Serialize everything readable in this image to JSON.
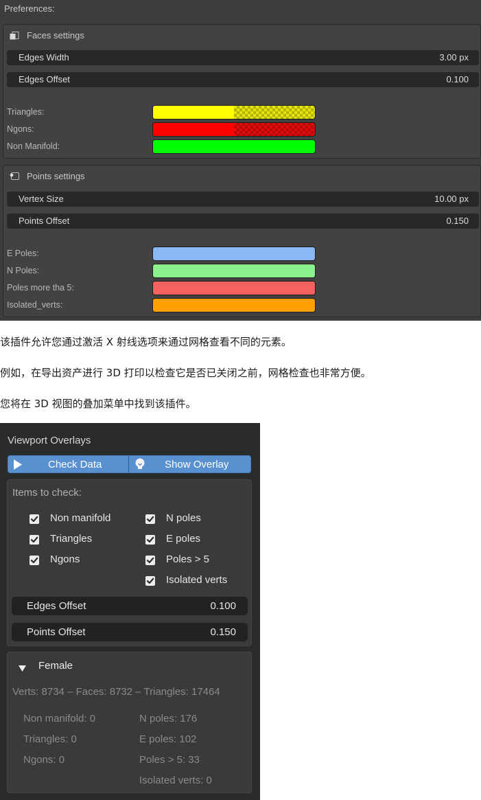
{
  "preferences": {
    "header": "Preferences:",
    "faces": {
      "title": "Faces settings",
      "icon": "faces-panel-icon",
      "edges_width": {
        "label": "Edges Width",
        "value": "3.00 px"
      },
      "edges_offset": {
        "label": "Edges Offset",
        "value": "0.100"
      },
      "colors": [
        {
          "label": "Triangles:",
          "color": "#ffff00",
          "alpha_checker": true
        },
        {
          "label": "Ngons:",
          "color": "#ff0000",
          "alpha_checker": true
        },
        {
          "label": "Non Manifold:",
          "color": "#00ff00",
          "alpha_checker": false
        }
      ]
    },
    "points": {
      "title": "Points settings",
      "icon": "points-panel-icon",
      "vertex_size": {
        "label": "Vertex Size",
        "value": "10.00 px"
      },
      "points_offset": {
        "label": "Points Offset",
        "value": "0.150"
      },
      "colors": [
        {
          "label": "E Poles:",
          "color": "#8ab8f7"
        },
        {
          "label": "N Poles:",
          "color": "#8cf08c"
        },
        {
          "label": "Poles more tha 5:",
          "color": "#f56161"
        },
        {
          "label": "Isolated_verts:",
          "color": "#ff9f00"
        }
      ]
    }
  },
  "paragraphs": [
    "该插件允许您通过激活 X 射线选项来通过网格查看不同的元素。",
    "例如，在导出资产进行 3D 打印以检查它是否已关闭之前，网格检查也非常方便。",
    "您将在 3D 视图的叠加菜单中找到该插件。"
  ],
  "overlays": {
    "title": "Viewport Overlays",
    "check_data_label": "Check Data",
    "show_overlay_label": "Show Overlay",
    "items_to_check_label": "Items to check:",
    "checkboxes_left": [
      "Non manifold",
      "Triangles",
      "Ngons"
    ],
    "checkboxes_right": [
      "N poles",
      "E poles",
      "Poles > 5",
      "Isolated verts"
    ],
    "edges_offset": {
      "label": "Edges Offset",
      "value": "0.100"
    },
    "points_offset": {
      "label": "Points Offset",
      "value": "0.150"
    },
    "object": {
      "name": "Female",
      "summary": "Verts: 8734 – Faces: 8732 – Triangles: 17464",
      "stats_left": [
        "Non manifold: 0",
        "Triangles: 0",
        "Ngons: 0"
      ],
      "stats_right": [
        "N poles: 176",
        "E poles: 102",
        "Poles > 5: 33",
        "Isolated verts: 0"
      ]
    }
  },
  "colors": {
    "accent_button": "#5990cf",
    "panel_dark": "#2b2b2b",
    "prefs_bg": "#3d3d3d"
  }
}
